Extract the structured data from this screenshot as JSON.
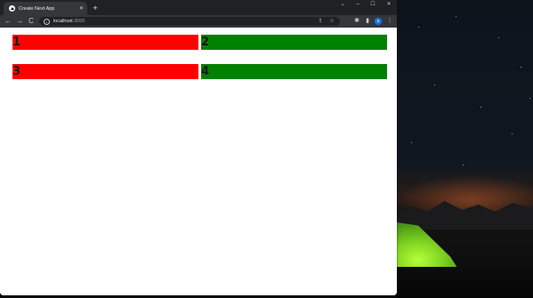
{
  "browser": {
    "tab": {
      "title": "Create Next App",
      "close_icon": "close-icon"
    },
    "new_tab_label": "+",
    "window_controls": {
      "minimize": "–",
      "maximize": "☐",
      "close": "✕"
    },
    "nav": {
      "back": "←",
      "forward": "→",
      "reload": "C"
    },
    "address": {
      "host": "localhost",
      "port": ":3000"
    },
    "profile_initial": "s"
  },
  "page": {
    "cells": [
      {
        "label": "1",
        "color": "#ff0000"
      },
      {
        "label": "2",
        "color": "#008000"
      },
      {
        "label": "3",
        "color": "#ff0000"
      },
      {
        "label": "4",
        "color": "#008000"
      }
    ]
  }
}
